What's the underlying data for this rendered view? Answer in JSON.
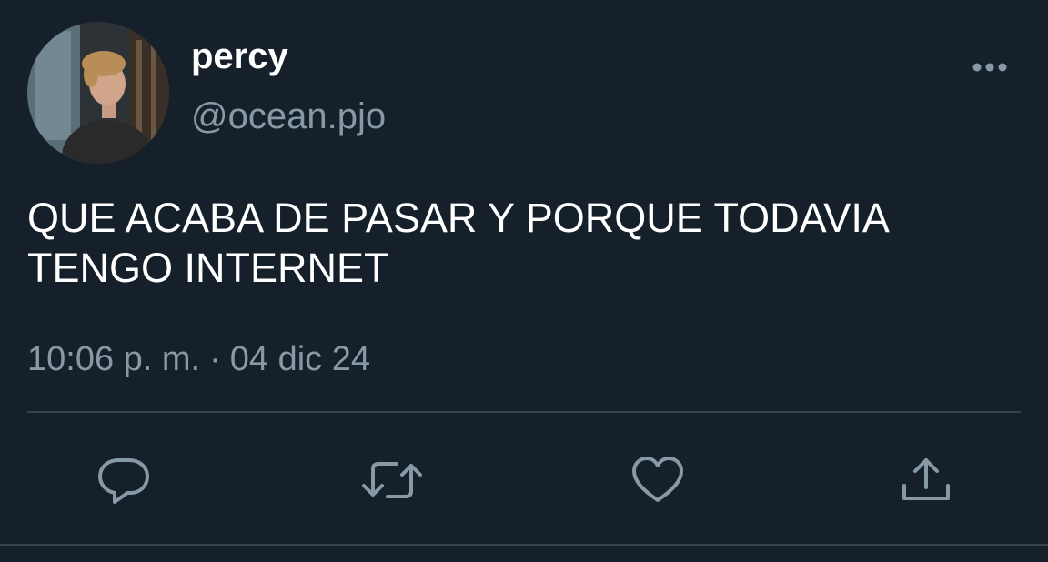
{
  "tweet": {
    "display_name": "percy",
    "handle": "@ocean.pjo",
    "text": "QUE ACABA DE PASAR Y PORQUE TODAVIA TENGO INTERNET",
    "time": "10:06 p. m.",
    "separator": "·",
    "date": "04 dic 24"
  },
  "icons": {
    "more": "more-horizontal-icon",
    "reply": "reply-icon",
    "retweet": "retweet-icon",
    "like": "heart-icon",
    "share": "share-icon"
  },
  "colors": {
    "background": "#15202b",
    "primary_text": "#ffffff",
    "secondary_text": "#8899a6",
    "divider": "#38444d"
  }
}
